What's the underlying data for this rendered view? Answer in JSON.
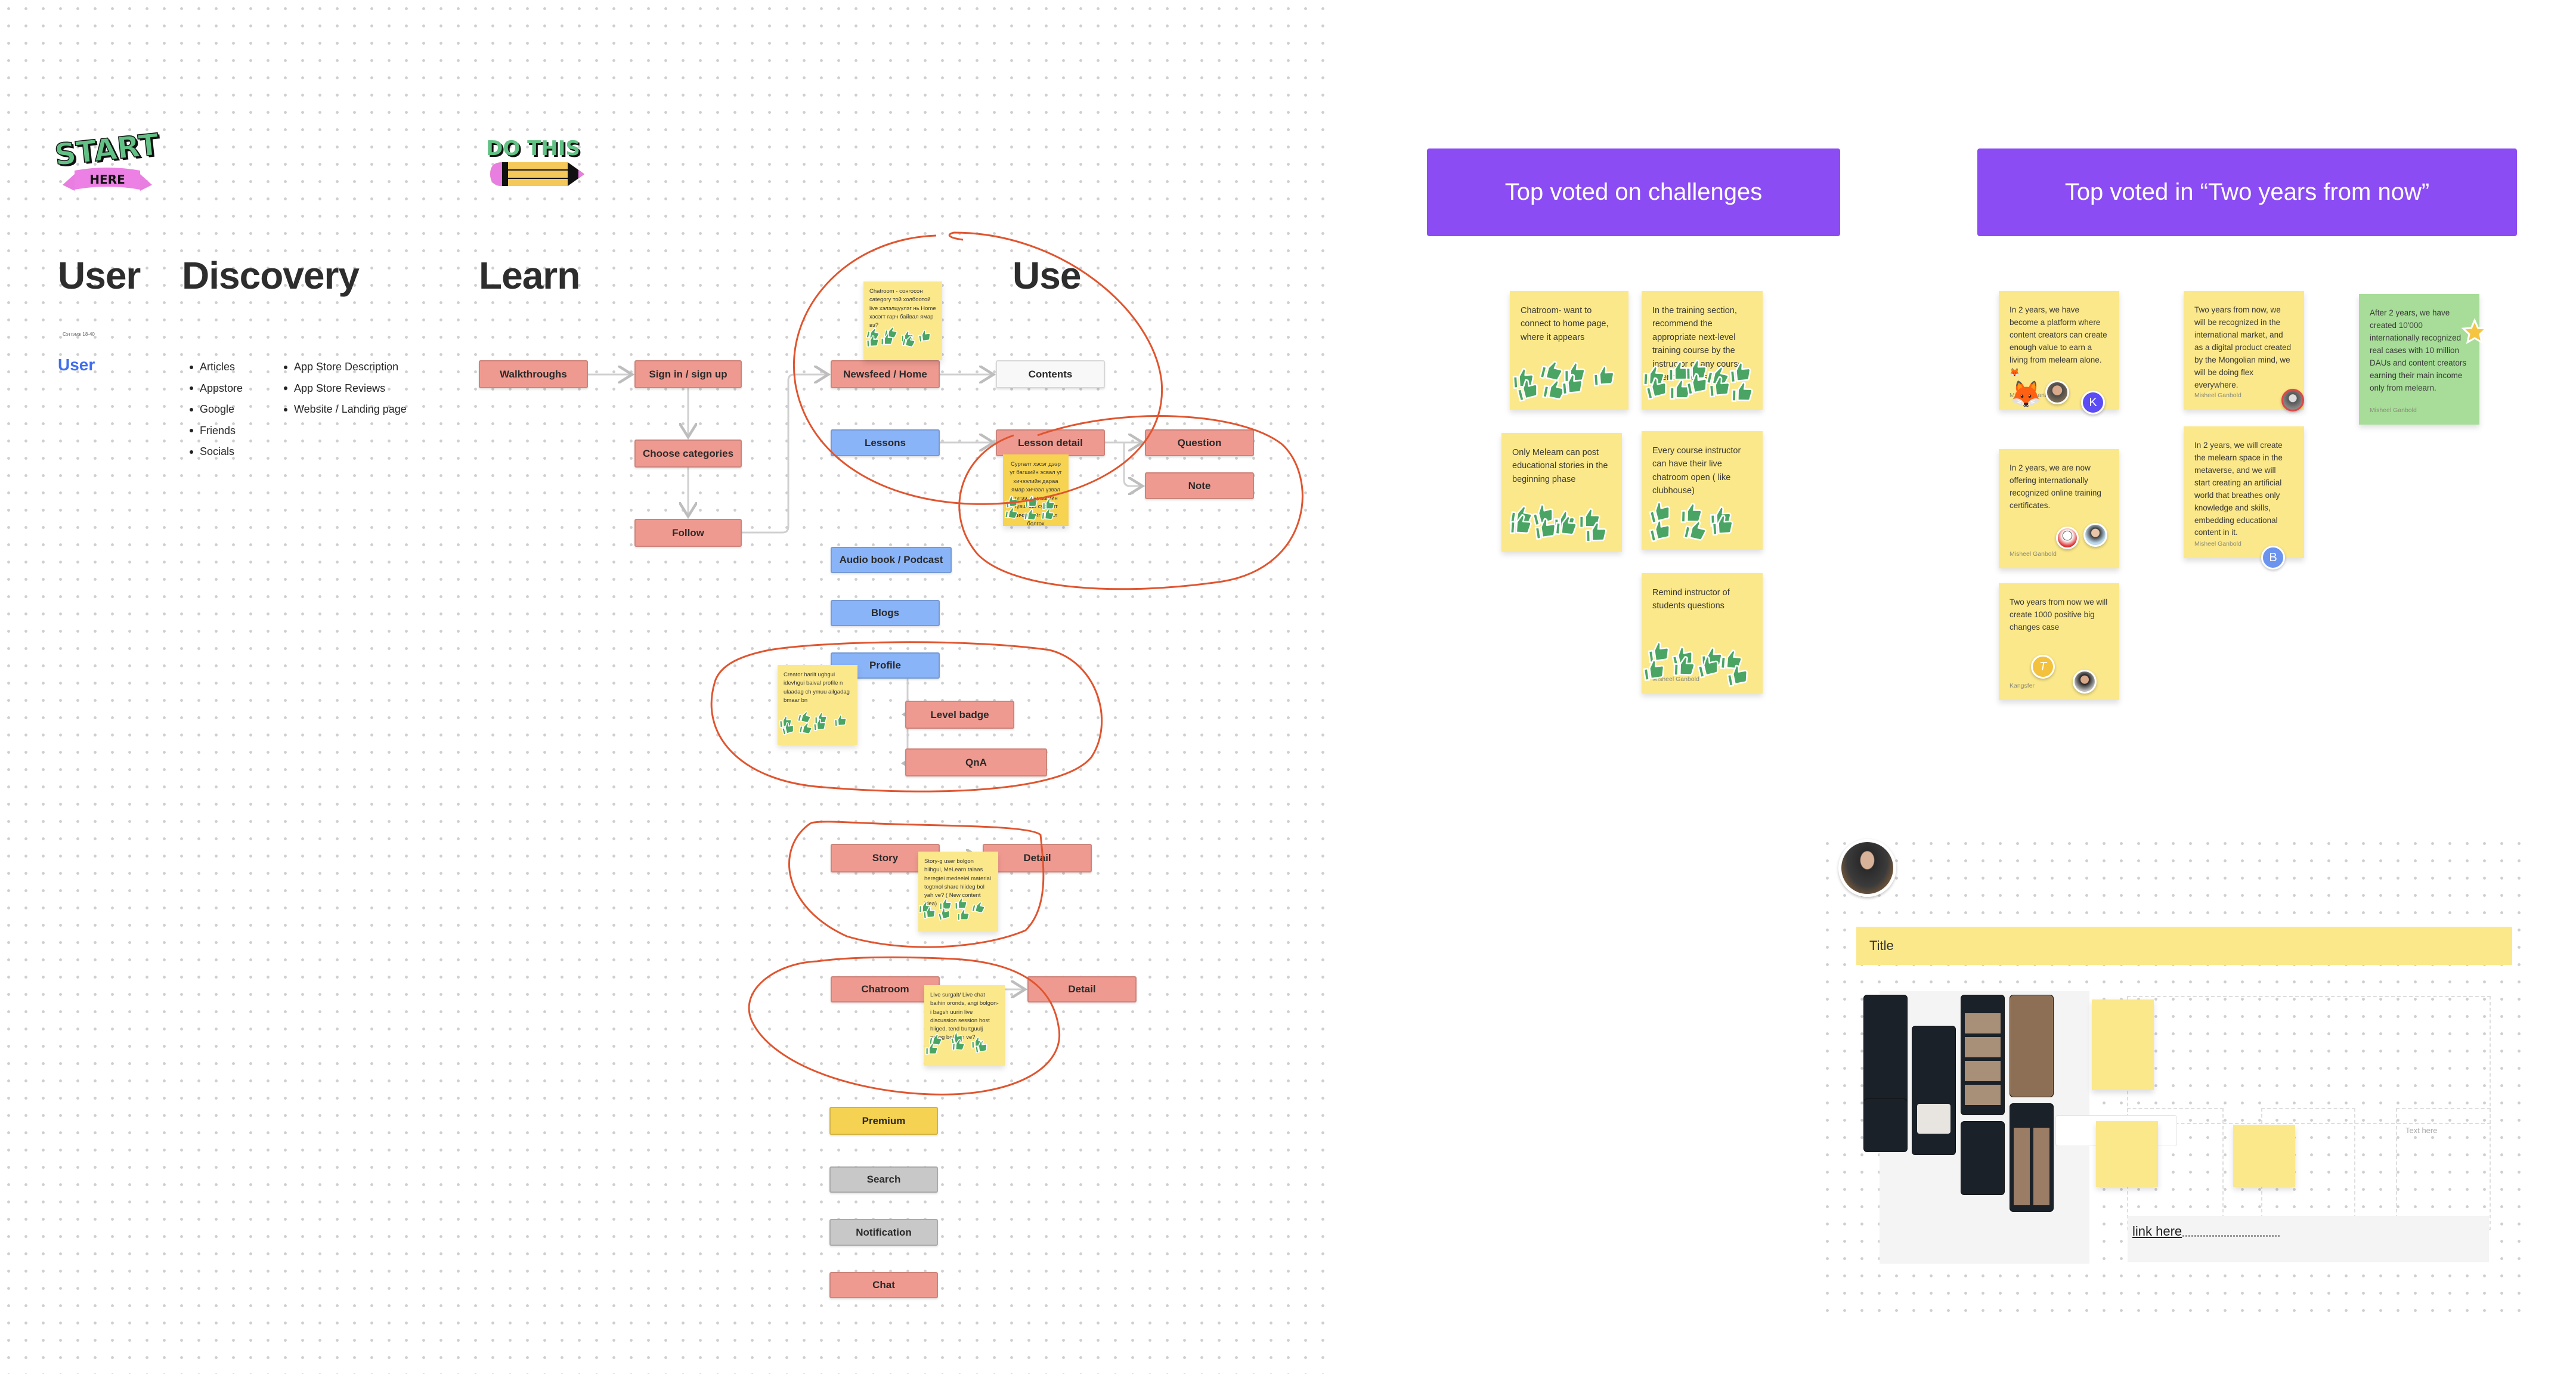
{
  "canvas": {
    "left_board": {
      "stickers": {
        "start_top": "START",
        "start_banner": "HERE",
        "do_this": "DO THIS"
      },
      "sections": {
        "user": "User",
        "discovery": "Discovery",
        "learn": "Learn",
        "use": "Use"
      },
      "user_meta": "Сэтгэмж 18-40",
      "user_link": "User",
      "discovery_list_1": [
        "Articles",
        "Appstore",
        "Google",
        "Friends",
        "Socials"
      ],
      "discovery_list_2": [
        "App Store Description",
        "App Store Reviews",
        "Website / Landing page"
      ],
      "flow": {
        "walkthroughs": "Walkthroughs",
        "sign_in": "Sign in / sign up",
        "choose_categories": "Choose categories",
        "follow": "Follow",
        "newsfeed": "Newsfeed / Home",
        "contents": "Contents",
        "lessons": "Lessons",
        "lesson_detail": "Lesson detail",
        "question": "Question",
        "note": "Note",
        "audio_book": "Audio book / Podcast",
        "blogs": "Blogs",
        "profile": "Profile",
        "level_badge": "Level badge",
        "qna": "QnA",
        "story": "Story",
        "story_detail": "Detail",
        "chatroom": "Chatroom",
        "chatroom_detail": "Detail",
        "premium": "Premium",
        "search": "Search",
        "notification": "Notification",
        "chat": "Chat"
      },
      "flow_notes": [
        {
          "id": "newsfeed-note",
          "text": "Chatroom - сонгосон category той холбоотой live хэлэлцүүлэг нь Home хэсэгт гарч байвал ямар вэ?",
          "votes": 7
        },
        {
          "id": "lesson-note",
          "text": "Сургалт хэсэг дээр уг багшийн эсвал уг хичээлийн дараа ямар хичээл үзвэл зүгээ, дараагийн түвшний сургалт хичээлийг санал болгох",
          "votes": 6
        },
        {
          "id": "profile-note",
          "text": "Creator harilt ughgui idevhgui baival profile n ulaadag ch ymuu ailgadag bmaar bn",
          "votes": 7
        },
        {
          "id": "story-note",
          "text": "Story-g user bolgon hiihgui, MeLearn talaas heregtei medeelel material togtmol share hiideg bol yah ve? ( New content idea)",
          "votes": 7
        },
        {
          "id": "chatroom-note",
          "text": "Live surgalt/ Live chat baihin oronds, angi bolgon-i bagsh uurin live discussion session host hiiged, tend burtguulj ordog bol yah ve?",
          "votes": 6
        }
      ]
    },
    "challenges": {
      "header": "Top voted on challenges",
      "notes": [
        {
          "text": "Chatroom- want to connect to home page, where it appears",
          "votes": 7
        },
        {
          "text": "In the training section, recommend the appropriate next-level training course by the instructor or any course after the course",
          "votes": 10
        },
        {
          "text": "Only Melearn can post educational stories in the beginning phase",
          "votes": 8
        },
        {
          "text": "Every course instructor can have their live chatroom open ( like clubhouse)",
          "votes": 6
        },
        {
          "text": "Remind instructor of students questions",
          "votes": 8,
          "author": "Misheel Ganbold"
        }
      ]
    },
    "two_years": {
      "header": "Top voted in “Two years from now”",
      "notes": [
        {
          "text": "In 2 years, we have become a platform where content creators can create enough value to earn a living from melearn alone.🦊",
          "author": "Misheel Ganbold",
          "voters": [
            "fox",
            "photo",
            "K"
          ]
        },
        {
          "text": "Two years from now, we will be recognized in the international market, and as a digital product created by the Mongolian mind, we will be doing flex everywhere.",
          "author": "Misheel Ganbold",
          "voters": [
            "photo"
          ]
        },
        {
          "text": "After 2 years, we have created 10'000 internationally recognized real cases with 10 million DAUs and content creators earning their main income only from melearn.",
          "author": "Misheel Ganbold",
          "color": "green",
          "voters": [
            "star"
          ]
        },
        {
          "text": "In 2 years, we are now offering internationally recognized online training certificates.",
          "author": "Misheel Ganbold",
          "voters": [
            "sketch",
            "photo"
          ]
        },
        {
          "text": "In 2 years, we will create the melearn space in the metaverse, and we will start creating an artificial world that breathes only knowledge and skills, embedding educational content in it.",
          "author": "Misheel Ganbold",
          "voters": [
            "B"
          ]
        },
        {
          "text": "Two years from now we will create 1000 positive big changes case",
          "author": "Kangsfer",
          "voters": [
            "T",
            "photo"
          ]
        }
      ]
    },
    "profile_board": {
      "title": "Title",
      "text_placeholder": "Text here",
      "link_label": "link here"
    },
    "colors": {
      "purple_header": "#8c4cf3",
      "sticky_yellow": "#fbe88a",
      "sticky_green": "#a7dd98",
      "box_red": "#ef9a90",
      "box_blue": "#8ab4f8",
      "box_yellow": "#f5d252",
      "box_grey": "#c8c8c8",
      "lasso_red": "#e0552f",
      "thumb_green": "#4aa564"
    }
  }
}
